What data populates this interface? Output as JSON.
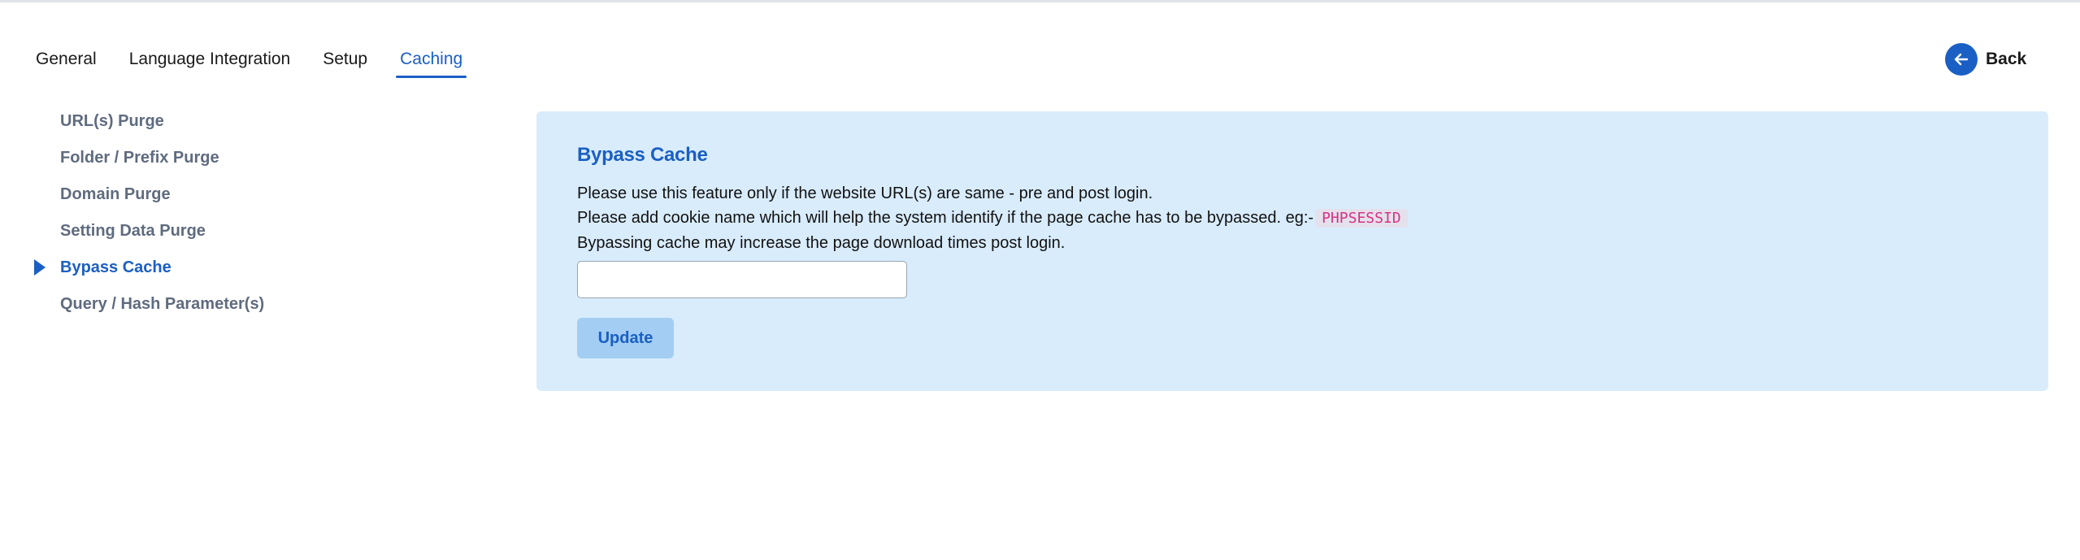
{
  "tabs": [
    {
      "label": "General"
    },
    {
      "label": "Language Integration"
    },
    {
      "label": "Setup"
    },
    {
      "label": "Caching"
    }
  ],
  "active_tab": "Caching",
  "back": {
    "label": "Back",
    "icon": "arrow-left-icon"
  },
  "sidebar": {
    "items": [
      {
        "label": "URL(s) Purge"
      },
      {
        "label": "Folder / Prefix Purge"
      },
      {
        "label": "Domain Purge"
      },
      {
        "label": "Setting Data Purge"
      },
      {
        "label": "Bypass Cache"
      },
      {
        "label": "Query / Hash Parameter(s)"
      }
    ],
    "active": "Bypass Cache"
  },
  "panel": {
    "title": "Bypass Cache",
    "line1": "Please use this feature only if the website URL(s) are same - pre and post login.",
    "line2": "Please add cookie name which will help the system identify if the page cache has to be bypassed. eg:-",
    "example_code": "PHPSESSID",
    "line3": "Bypassing cache may increase the page download times post login.",
    "input_value": "",
    "input_placeholder": "",
    "update_label": "Update"
  },
  "colors": {
    "accent": "#1a5fc4",
    "panel_bg": "#d9ecfc",
    "button_bg": "#a3cdf2",
    "code_text": "#d63384"
  }
}
